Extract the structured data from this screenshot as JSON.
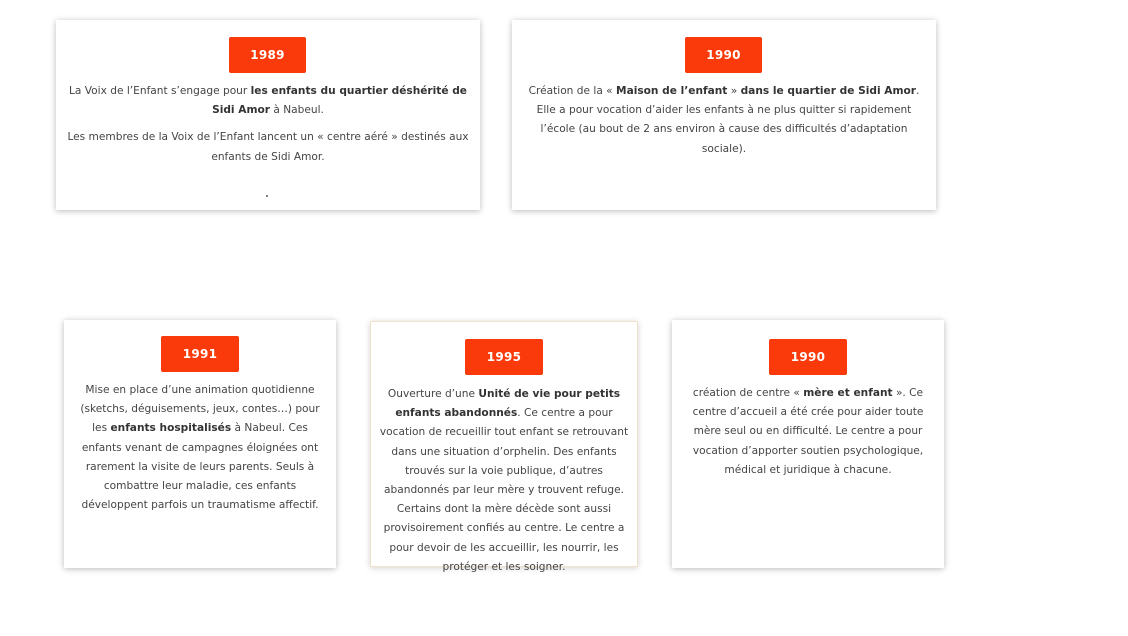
{
  "cards": [
    {
      "year": "1989",
      "paragraphs": [
        [
          {
            "t": "La Voix de l’Enfant s’engage pour ",
            "b": false
          },
          {
            "t": "les enfants du quartier déshérité de Sidi Amor",
            "b": true
          },
          {
            "t": " à Nabeul.",
            "b": false
          }
        ],
        [
          {
            "t": "Les membres de la Voix de l’Enfant lancent un « centre aéré » destinés aux enfants de Sidi Amor.",
            "b": false
          }
        ]
      ],
      "trailing": "."
    },
    {
      "year": "1990",
      "paragraphs": [
        [
          {
            "t": "Création de la « ",
            "b": false
          },
          {
            "t": "Maison de l’enfant",
            "b": true
          },
          {
            "t": " » ",
            "b": false
          },
          {
            "t": "dans le quartier de Sidi Amor",
            "b": true
          },
          {
            "t": ". Elle a pour vocation d’aider les enfants à ne plus quitter si rapidement l’école (au bout de 2 ans environ à cause des difficultés d’adaptation sociale).",
            "b": false
          }
        ]
      ]
    },
    {
      "year": "1991",
      "paragraphs": [
        [
          {
            "t": "Mise en place d’une animation quotidienne (sketchs, déguisements, jeux, contes…) pour les ",
            "b": false
          },
          {
            "t": "enfants hospitalisés",
            "b": true
          },
          {
            "t": " à Nabeul. Ces enfants venant de campagnes éloignées ont rarement la visite de leurs parents. Seuls à combattre leur maladie, ces enfants développent parfois un traumatisme affectif.",
            "b": false
          }
        ]
      ]
    },
    {
      "year": "1995",
      "paragraphs": [
        [
          {
            "t": "Ouverture d’une ",
            "b": false
          },
          {
            "t": "Unité de vie pour petits enfants abandonnés",
            "b": true
          },
          {
            "t": ". Ce centre a pour vocation de recueillir tout enfant se retrouvant dans une situation d’orphelin. Des enfants trouvés sur la voie publique, d’autres abandonnés par leur mère y trouvent refuge. Certains dont la mère décède sont aussi provisoirement confiés au centre. Le centre a pour devoir de les accueillir, les nourrir, les protéger et les soigner.",
            "b": false
          }
        ]
      ]
    },
    {
      "year": "1990",
      "paragraphs": [
        [
          {
            "t": "création de centre « ",
            "b": false
          },
          {
            "t": "mère et enfant",
            "b": true
          },
          {
            "t": " ». Ce centre d’accueil a été crée pour aider toute mère seul ou en difficulté. Le centre a pour vocation d’apporter soutien psychologique, médical et juridique à chacune.",
            "b": false
          }
        ]
      ]
    }
  ],
  "colors": {
    "accent": "#fa3a0a"
  }
}
